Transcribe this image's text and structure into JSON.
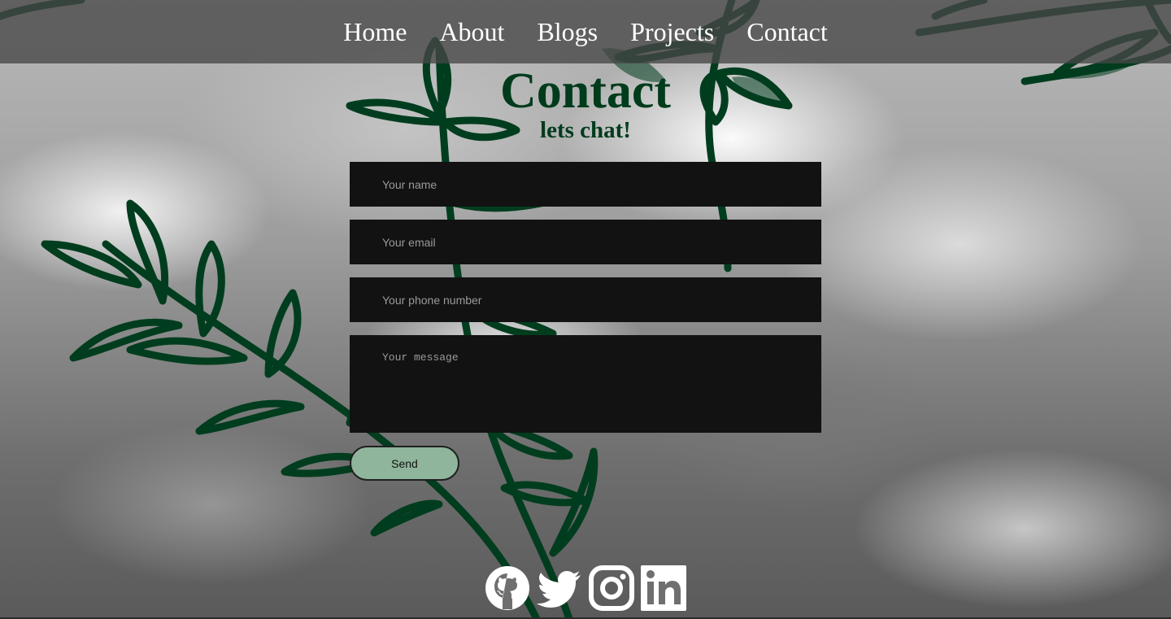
{
  "nav": {
    "items": [
      {
        "label": "Home"
      },
      {
        "label": "About"
      },
      {
        "label": "Blogs"
      },
      {
        "label": "Projects"
      },
      {
        "label": "Contact"
      }
    ]
  },
  "header": {
    "title": "Contact",
    "subtitle": "lets chat!"
  },
  "form": {
    "name_placeholder": "Your name",
    "email_placeholder": "Your email",
    "phone_placeholder": "Your phone number",
    "message_placeholder": "Your message",
    "send_label": "Send"
  },
  "social": {
    "icons": [
      "github-icon",
      "twitter-icon",
      "instagram-icon",
      "linkedin-icon"
    ]
  },
  "colors": {
    "accent_green": "#003b1c",
    "button_green": "#8fb59d",
    "input_bg": "#121212",
    "nav_bg": "#464646"
  }
}
